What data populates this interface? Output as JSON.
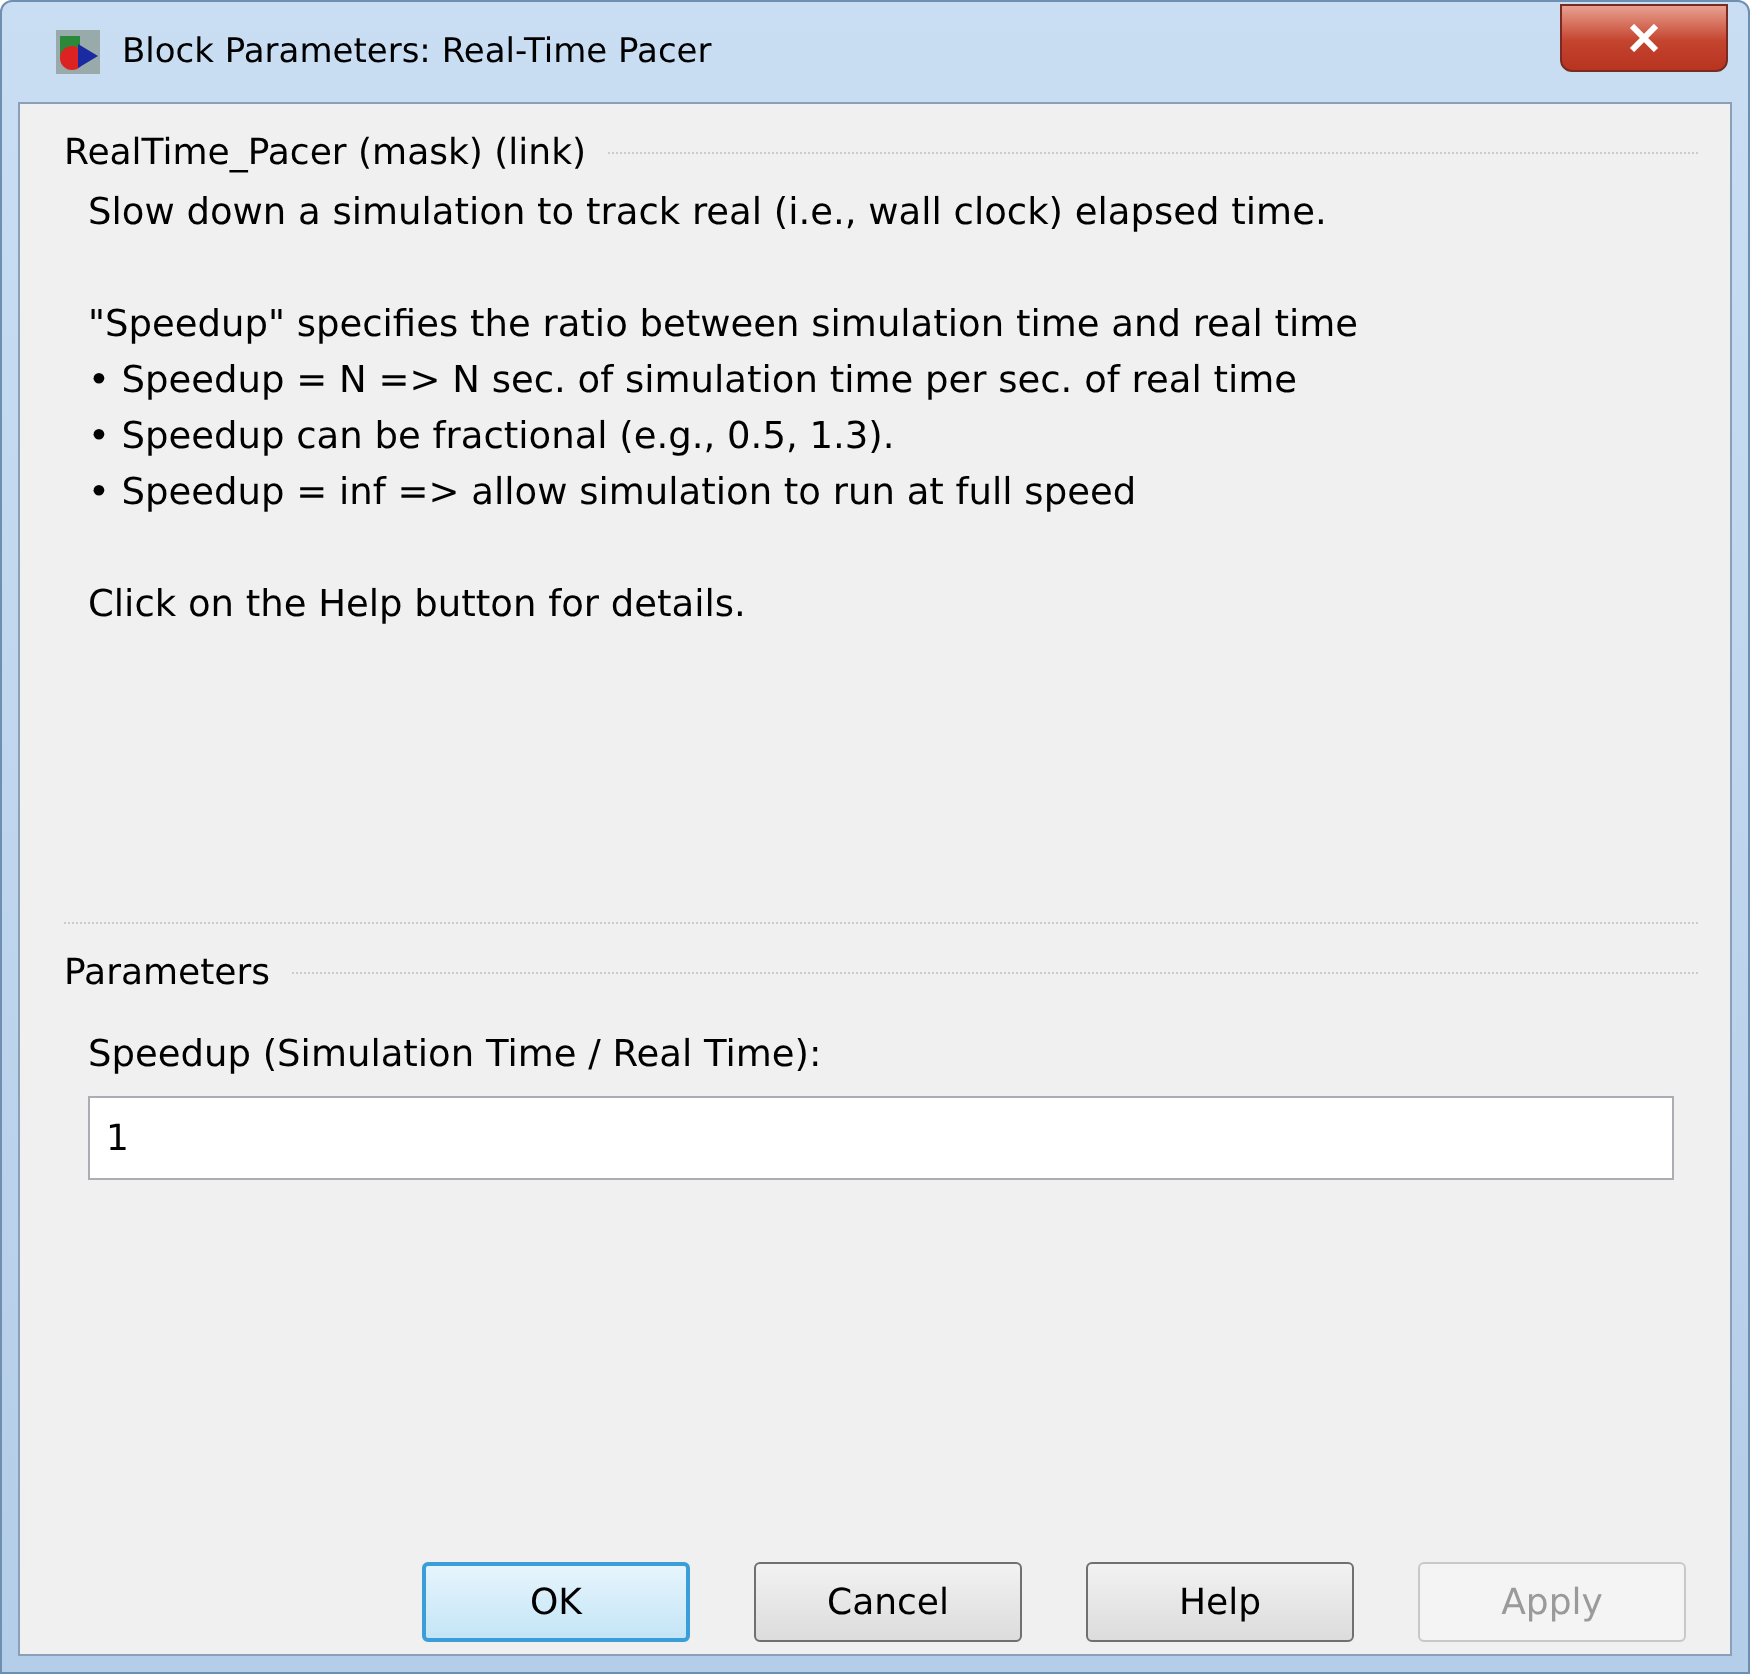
{
  "window": {
    "title": "Block Parameters: Real-Time Pacer"
  },
  "description": {
    "title": "RealTime_Pacer (mask) (link)",
    "paragraphs": [
      {
        "kind": "text",
        "text": "Slow down a simulation to track real (i.e., wall clock) elapsed time."
      },
      {
        "kind": "text",
        "text": "\"Speedup\" specifies the ratio between simulation time and real time"
      },
      {
        "kind": "bullet",
        "text": "• Speedup = N => N sec. of simulation time per sec. of real time"
      },
      {
        "kind": "bullet",
        "text": "• Speedup can be fractional (e.g., 0.5, 1.3)."
      },
      {
        "kind": "bullet",
        "text": "• Speedup = inf => allow simulation to run at full speed"
      },
      {
        "kind": "gap"
      },
      {
        "kind": "text",
        "text": "Click on the Help button for details."
      }
    ]
  },
  "parameters": {
    "title": "Parameters",
    "fields": [
      {
        "label": "Speedup (Simulation Time / Real Time):",
        "value": "1"
      }
    ]
  },
  "buttons": [
    {
      "label": "OK",
      "default": true,
      "disabled": false
    },
    {
      "label": "Cancel",
      "default": false,
      "disabled": false
    },
    {
      "label": "Help",
      "default": false,
      "disabled": false
    },
    {
      "label": "Apply",
      "default": false,
      "disabled": true
    }
  ]
}
